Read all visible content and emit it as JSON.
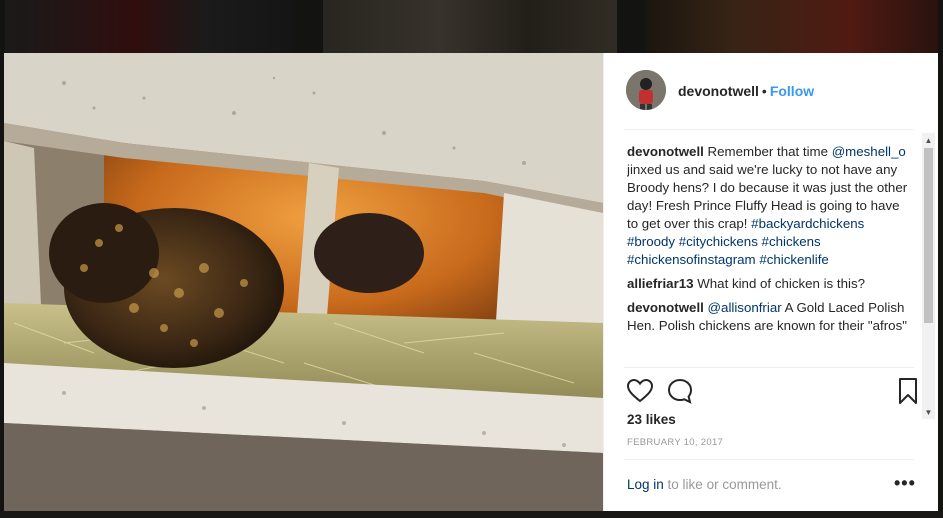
{
  "post": {
    "username": "devonotwell",
    "separator": "•",
    "follow_label": "Follow",
    "likes": "23 likes",
    "date": "FEBRUARY 10, 2017"
  },
  "comments": [
    {
      "user": "devonotwell",
      "parts": [
        {
          "t": " Remember that time "
        },
        {
          "t": "@meshell_o",
          "link": true
        },
        {
          "t": " jinxed us and said we're lucky to not have any Broody hens? I do because it was just the other day! Fresh Prince Fluffy Head is going to have to get over this crap! "
        },
        {
          "t": "#backyardchickens",
          "link": true
        },
        {
          "t": " "
        },
        {
          "t": "#broody",
          "link": true
        },
        {
          "t": " "
        },
        {
          "t": "#citychickens",
          "link": true
        },
        {
          "t": " "
        },
        {
          "t": "#chickens",
          "link": true
        },
        {
          "t": " "
        },
        {
          "t": "#chickensofinstagram",
          "link": true
        },
        {
          "t": " "
        },
        {
          "t": "#chickenlife",
          "link": true
        }
      ]
    },
    {
      "user": "alliefriar13",
      "parts": [
        {
          "t": " What kind of chicken is this?"
        }
      ]
    },
    {
      "user": "devonotwell",
      "parts": [
        {
          "t": " "
        },
        {
          "t": "@allisonfriar",
          "link": true
        },
        {
          "t": " A Gold Laced Polish Hen. Polish chickens are known for their \"afros\""
        }
      ]
    }
  ],
  "footer": {
    "login_link": "Log in",
    "login_rest": " to like or comment.",
    "more": "•••"
  },
  "icons": {
    "like": "heart-icon",
    "comment": "comment-icon",
    "save": "bookmark-icon",
    "more": "more-options-icon"
  },
  "colors": {
    "follow": "#3897f0",
    "link": "#003569",
    "text": "#262626",
    "muted": "#999999"
  }
}
